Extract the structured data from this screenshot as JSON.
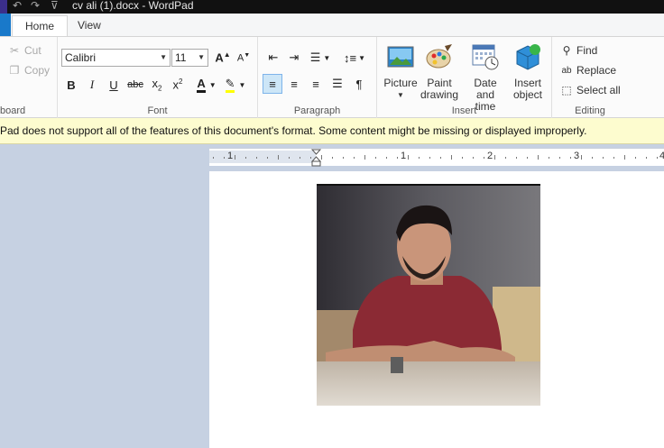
{
  "window": {
    "title": "cv ali (1).docx - WordPad",
    "quick_access": {
      "undo_glyph": "↶",
      "redo_glyph": "↷",
      "menu_glyph": "⊽"
    }
  },
  "tabs": [
    {
      "label": "Home",
      "active": true
    },
    {
      "label": "View",
      "active": false
    }
  ],
  "ribbon": {
    "clipboard": {
      "cut": "Cut",
      "copy": "Copy",
      "label": "board"
    },
    "font": {
      "family": "Calibri",
      "size": "11",
      "label": "Font",
      "text_color": "#1a1a1a",
      "highlight_color": "#ffff00"
    },
    "paragraph": {
      "label": "Paragraph"
    },
    "insert": {
      "picture": "Picture",
      "paint": [
        "Paint",
        "drawing"
      ],
      "datetime": [
        "Date and",
        "time"
      ],
      "object": [
        "Insert",
        "object"
      ],
      "label": "Insert"
    },
    "editing": {
      "find": "Find",
      "replace": "Replace",
      "select_all": "Select all",
      "label": "Editing"
    }
  },
  "notice": {
    "text": "Pad does not support all of the features of this document's format. Some content might be missing or displayed improperly."
  },
  "ruler": {
    "labels": [
      "1",
      "1",
      "2",
      "3",
      "4"
    ]
  },
  "colors": {
    "accent": "#1979ca",
    "notice_bg": "#fdfccf",
    "workspace": "#c6d1e2"
  }
}
